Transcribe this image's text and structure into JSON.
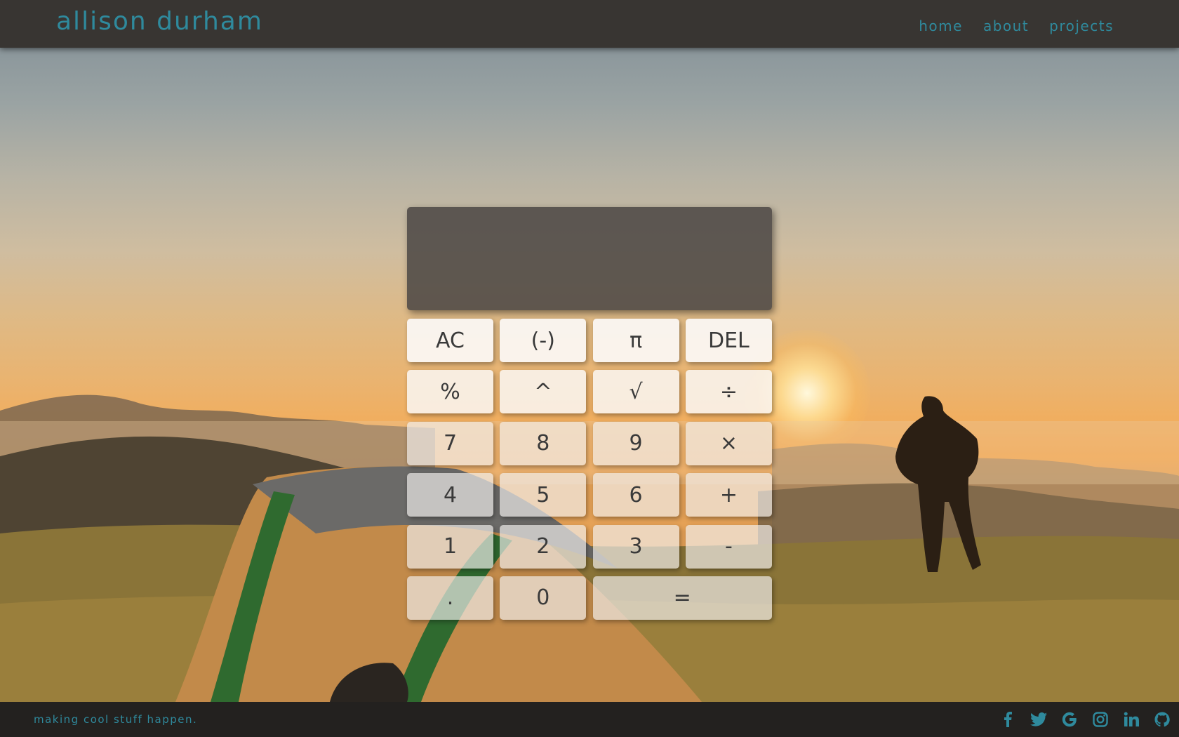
{
  "header": {
    "brand": "allison durham",
    "nav": [
      "home",
      "about",
      "projects"
    ]
  },
  "calculator": {
    "display_value": "",
    "keys": {
      "ac": "AC",
      "negate": "(-)",
      "pi": "π",
      "del": "DEL",
      "percent": "%",
      "power": "^",
      "sqrt": "√",
      "divide": "÷",
      "seven": "7",
      "eight": "8",
      "nine": "9",
      "multiply": "×",
      "four": "4",
      "five": "5",
      "six": "6",
      "plus": "+",
      "one": "1",
      "two": "2",
      "three": "3",
      "minus": "-",
      "dot": ".",
      "zero": "0",
      "equals": "="
    }
  },
  "footer": {
    "tagline": "making cool stuff happen.",
    "social_icons": [
      "facebook-icon",
      "twitter-icon",
      "google-icon",
      "instagram-icon",
      "linkedin-icon",
      "github-icon"
    ]
  },
  "colors": {
    "accent": "#2f8a9d",
    "header_bg": "#383532",
    "footer_bg": "#23211f",
    "display_bg": "#4a4644"
  }
}
